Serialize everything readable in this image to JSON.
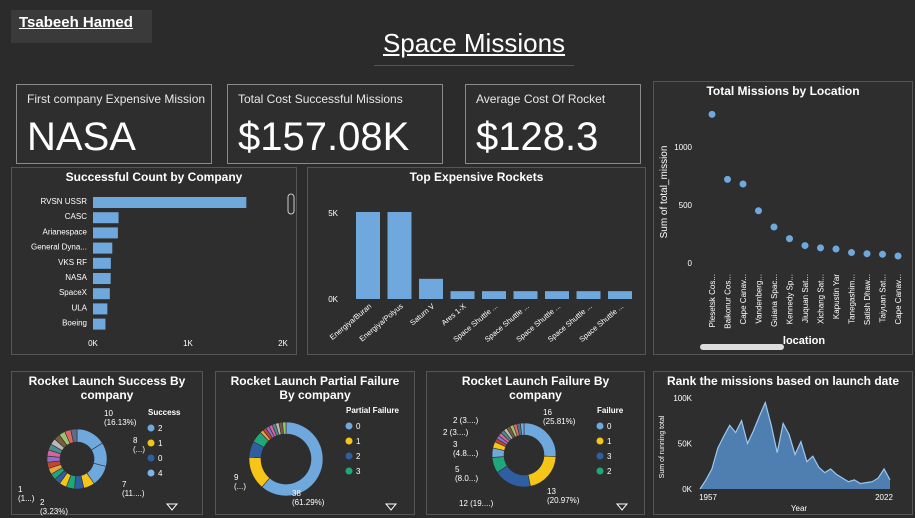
{
  "author": "Tsabeeh Hamed",
  "title": "Space Missions",
  "kpis": [
    {
      "label": "First company Expensive Mission",
      "value": "NASA"
    },
    {
      "label": "Total Cost Successful Missions",
      "value": "$157.08K"
    },
    {
      "label": "Average Cost Of Rocket",
      "value": "$128.3"
    }
  ],
  "colors": {
    "bar": "#6fa8dc",
    "s0": "#6fa8dc",
    "s1": "#f5c518",
    "s2": "#2f5fa0",
    "s3": "#1fa67a",
    "s4": "#7fb3e6"
  },
  "chart_data": [
    {
      "id": "company",
      "type": "bar",
      "title": "Successful Count by Company",
      "categories": [
        "RVSN USSR",
        "CASC",
        "Arianespace",
        "General Dyna...",
        "VKS RF",
        "NASA",
        "SpaceX",
        "ULA",
        "Boeing"
      ],
      "values": [
        1614,
        269,
        262,
        203,
        188,
        186,
        177,
        151,
        131
      ],
      "xticks": [
        "0K",
        "1K",
        "2K"
      ],
      "xlim": [
        0,
        2000
      ]
    },
    {
      "id": "rockets",
      "type": "bar",
      "title": "Top Expensive Rockets",
      "categories": [
        "Energiya/Buran",
        "Energiya/Polyus",
        "Saturn V",
        "Ares 1-X",
        "Space Shuttle ...",
        "Space Shuttle ...",
        "Space Shuttle ...",
        "Space Shuttle ...",
        "Space Shuttle ..."
      ],
      "values": [
        5000,
        5000,
        1160,
        450,
        450,
        450,
        450,
        450,
        450
      ],
      "yticks": [
        "5K",
        "0K"
      ],
      "ylim": [
        0,
        5000
      ]
    },
    {
      "id": "location",
      "type": "scatter",
      "title": "Total Missions by Location",
      "ylabel": "Sum of total_mission",
      "xlabel": "location",
      "categories": [
        "Plesetsk Cos...",
        "Baikonur Cos...",
        "Cape Canav...",
        "Vandenberg...",
        "Guiana Spac...",
        "Kennedy Sp...",
        "Jiuquan Sat...",
        "Xichang Sat...",
        "Kapustin Yar",
        "Tanegashim...",
        "Satish Dhaw...",
        "Taiyuan Sat...",
        "Cape Canav..."
      ],
      "values": [
        1280,
        720,
        680,
        450,
        310,
        210,
        150,
        130,
        120,
        90,
        80,
        75,
        60
      ],
      "yticks": [
        "1000",
        "500",
        "0"
      ],
      "ylim": [
        0,
        1300
      ]
    },
    {
      "id": "success",
      "type": "pie",
      "title": "Rocket Launch Success By company",
      "legend_title": "Success",
      "legend": [
        "2",
        "1",
        "0",
        "4"
      ],
      "labels": [
        {
          "text": "10",
          "sub": "(16.13%)"
        },
        {
          "text": "8",
          "sub": "(...)"
        },
        {
          "text": "7",
          "sub": "(11....)"
        },
        {
          "text": "2",
          "sub": "(3.23%)"
        },
        {
          "text": "1",
          "sub": "(1...)"
        }
      ]
    },
    {
      "id": "partial",
      "type": "pie",
      "title": "Rocket Launch Partial Failure By company",
      "legend_title": "Partial Failure",
      "legend": [
        "0",
        "1",
        "2",
        "3"
      ],
      "labels": [
        {
          "text": "9",
          "sub": "(...)"
        },
        {
          "text": "38",
          "sub": "(61.29%)"
        }
      ]
    },
    {
      "id": "failure",
      "type": "pie",
      "title": "Rocket Launch Failure By company",
      "legend_title": "Failure",
      "legend": [
        "0",
        "1",
        "3",
        "2"
      ],
      "labels": [
        {
          "text": "16",
          "sub": "(25.81%)"
        },
        {
          "text": "2 (3....)",
          "sub": ""
        },
        {
          "text": "2 (3....)",
          "sub": ""
        },
        {
          "text": "3",
          "sub": "(4.8....)"
        },
        {
          "text": "5",
          "sub": "(8.0...)"
        },
        {
          "text": "12 (19....)",
          "sub": ""
        },
        {
          "text": "13",
          "sub": "(20.97%)"
        }
      ]
    },
    {
      "id": "rank",
      "type": "area",
      "title": "Rank the missions based on launch date",
      "ylabel": "Sum of running total",
      "xlabel": "Year",
      "yticks": [
        "100K",
        "50K",
        "0K"
      ],
      "xticks": [
        "1957",
        "2022"
      ],
      "ylim": [
        0,
        100000
      ],
      "values": [
        0,
        10000,
        22000,
        45000,
        58000,
        70000,
        62000,
        75000,
        50000,
        64000,
        80000,
        95000,
        70000,
        40000,
        72000,
        60000,
        38000,
        52000,
        30000,
        36000,
        24000,
        18000,
        22000,
        16000,
        12000,
        8000,
        10000,
        6000,
        7000,
        8000,
        12000,
        22000,
        10000
      ]
    }
  ]
}
